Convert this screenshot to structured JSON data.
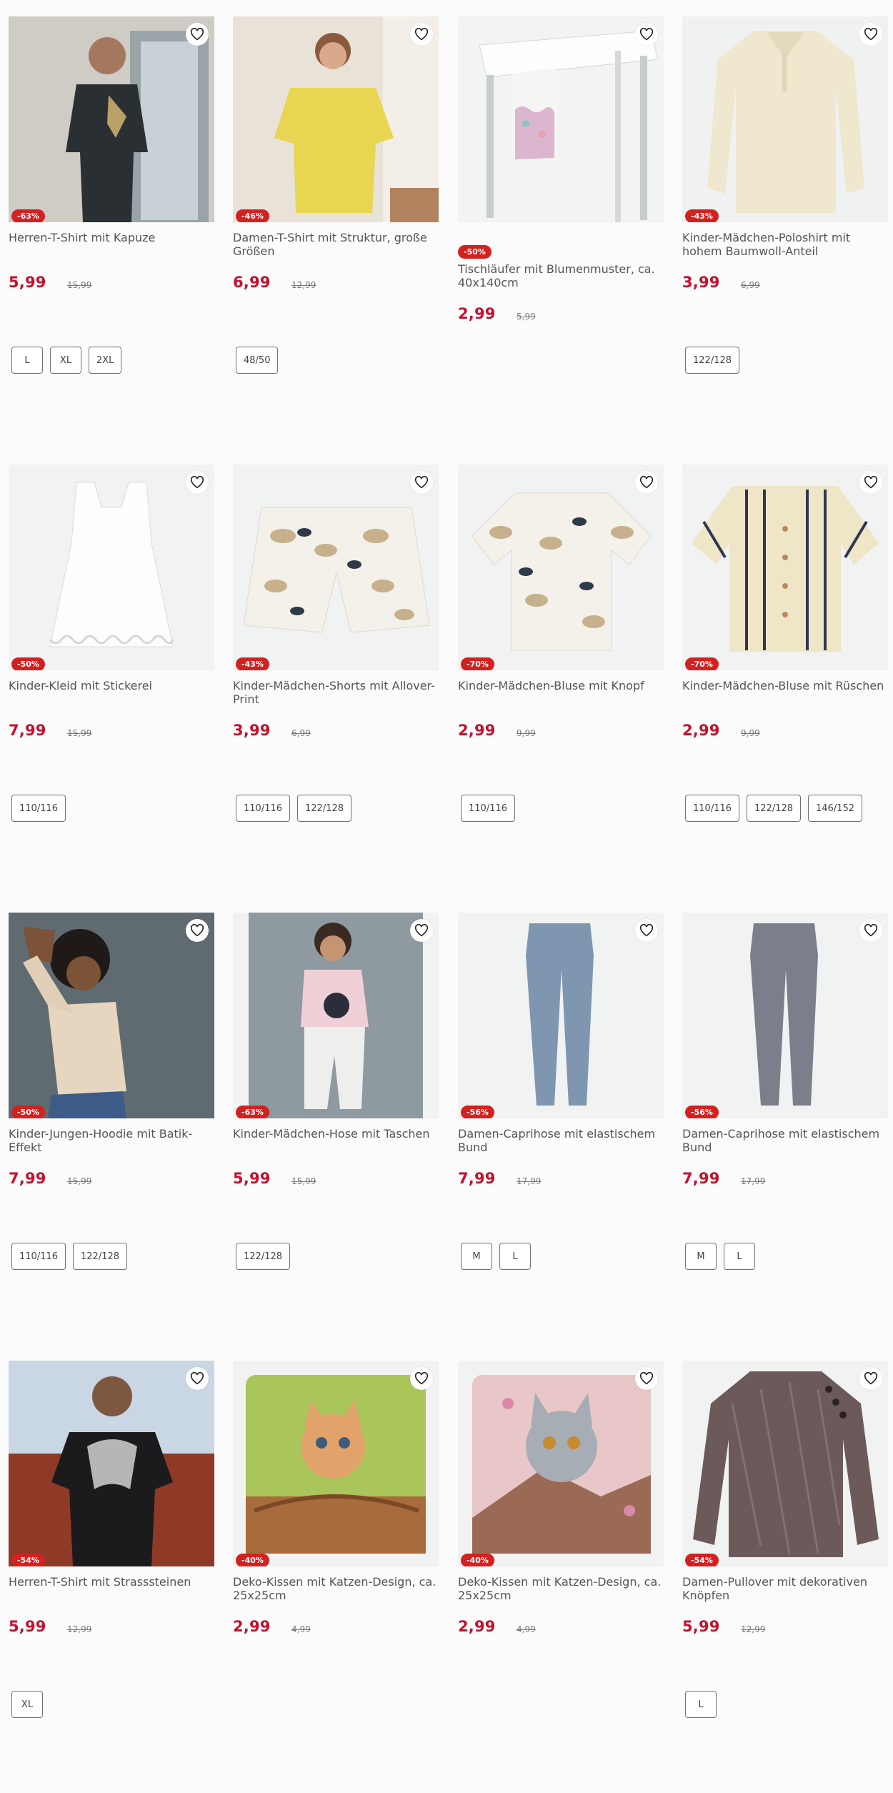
{
  "products": [
    {
      "title": "Herren-T-Shirt mit Kapuze",
      "discount": "-63%",
      "price": "5,99",
      "old_price": "15,99",
      "sizes": [
        "L",
        "XL",
        "2XL"
      ],
      "image": "man-black-tshirt",
      "favorite_icon": "heart-icon"
    },
    {
      "title": "Damen-T-Shirt mit Struktur, große Größen",
      "discount": "-46%",
      "price": "6,99",
      "old_price": "12,99",
      "sizes": [
        "48/50"
      ],
      "image": "woman-yellow-tshirt",
      "favorite_icon": "heart-icon"
    },
    {
      "title": "Tischläufer mit Blumenmuster, ca. 40x140cm",
      "discount": "-50%",
      "price": "2,99",
      "old_price": "5,99",
      "sizes": [],
      "image": "table-runner",
      "favorite_icon": "heart-icon"
    },
    {
      "title": "Kinder-Mädchen-Poloshirt mit hohem Baumwoll-Anteil",
      "discount": "-43%",
      "price": "3,99",
      "old_price": "6,99",
      "sizes": [
        "122/128"
      ],
      "image": "cream-polo",
      "favorite_icon": "heart-icon"
    },
    {
      "title": "Kinder-Kleid mit Stickerei",
      "discount": "-50%",
      "price": "7,99",
      "old_price": "15,99",
      "sizes": [
        "110/116"
      ],
      "image": "white-dress",
      "favorite_icon": "heart-icon"
    },
    {
      "title": "Kinder-Mädchen-Shorts mit Allover-Print",
      "discount": "-43%",
      "price": "3,99",
      "old_price": "6,99",
      "sizes": [
        "110/116",
        "122/128"
      ],
      "image": "leaf-shorts",
      "favorite_icon": "heart-icon"
    },
    {
      "title": "Kinder-Mädchen-Bluse mit Knopf",
      "discount": "-70%",
      "price": "2,99",
      "old_price": "9,99",
      "sizes": [
        "110/116"
      ],
      "image": "leaf-blouse",
      "favorite_icon": "heart-icon"
    },
    {
      "title": "Kinder-Mädchen-Bluse mit Rüschen",
      "discount": "-70%",
      "price": "2,99",
      "old_price": "9,99",
      "sizes": [
        "110/116",
        "122/128",
        "146/152"
      ],
      "image": "striped-blouse",
      "favorite_icon": "heart-icon"
    },
    {
      "title": "Kinder-Jungen-Hoodie mit Batik-Effekt",
      "discount": "-50%",
      "price": "7,99",
      "old_price": "15,99",
      "sizes": [
        "110/116",
        "122/128"
      ],
      "image": "boy-hoodie",
      "favorite_icon": "heart-icon"
    },
    {
      "title": "Kinder-Mädchen-Hose mit Taschen",
      "discount": "-63%",
      "price": "5,99",
      "old_price": "15,99",
      "sizes": [
        "122/128"
      ],
      "image": "girl-pants",
      "favorite_icon": "heart-icon"
    },
    {
      "title": "Damen-Caprihose mit elastischem Bund",
      "discount": "-56%",
      "price": "7,99",
      "old_price": "17,99",
      "sizes": [
        "M",
        "L"
      ],
      "image": "blue-leggings",
      "favorite_icon": "heart-icon"
    },
    {
      "title": "Damen-Caprihose mit elastischem Bund",
      "discount": "-56%",
      "price": "7,99",
      "old_price": "17,99",
      "sizes": [
        "M",
        "L"
      ],
      "image": "grey-leggings",
      "favorite_icon": "heart-icon"
    },
    {
      "title": "Herren-T-Shirt mit Strasssteinen",
      "discount": "-54%",
      "price": "5,99",
      "old_price": "12,99",
      "sizes": [
        "XL"
      ],
      "image": "man-print-tshirt",
      "favorite_icon": "heart-icon"
    },
    {
      "title": "Deko-Kissen mit Katzen-Design, ca. 25x25cm",
      "discount": "-40%",
      "price": "2,99",
      "old_price": "4,99",
      "sizes": [],
      "image": "cat-pillow-orange",
      "favorite_icon": "heart-icon"
    },
    {
      "title": "Deko-Kissen mit Katzen-Design, ca. 25x25cm",
      "discount": "-40%",
      "price": "2,99",
      "old_price": "4,99",
      "sizes": [],
      "image": "cat-pillow-grey",
      "favorite_icon": "heart-icon"
    },
    {
      "title": "Damen-Pullover mit dekorativen Knöpfen",
      "discount": "-54%",
      "price": "5,99",
      "old_price": "12,99",
      "sizes": [
        "L"
      ],
      "image": "knit-pullover",
      "favorite_icon": "heart-icon"
    }
  ],
  "colors": {
    "price": "#c5102e",
    "badge": "#d52020"
  }
}
